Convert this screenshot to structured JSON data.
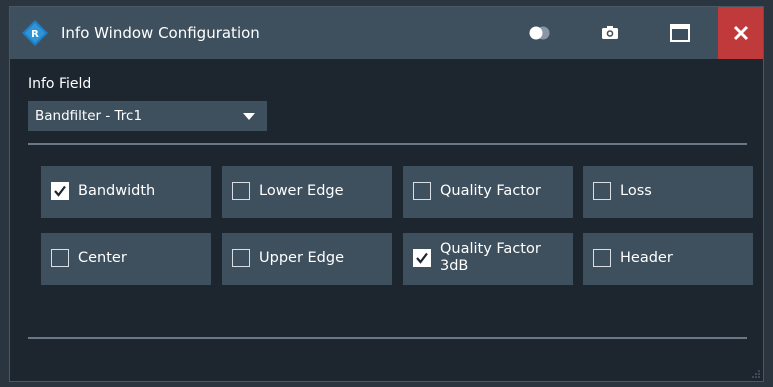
{
  "window": {
    "title": "Info Window Configuration",
    "toolbar_icons": [
      "toggle-icon",
      "camera-icon",
      "maximize-icon",
      "close-icon"
    ]
  },
  "info_field": {
    "label": "Info Field",
    "selected": "Bandfilter - Trc1"
  },
  "checkboxes": [
    {
      "label": "Bandwidth",
      "checked": true
    },
    {
      "label": "Lower Edge",
      "checked": false
    },
    {
      "label": "Quality Factor",
      "checked": false
    },
    {
      "label": "Loss",
      "checked": false
    },
    {
      "label": "Center",
      "checked": false
    },
    {
      "label": "Upper Edge",
      "checked": false
    },
    {
      "label": "Quality Factor 3dB",
      "checked": true
    },
    {
      "label": "Header",
      "checked": false
    }
  ],
  "colors": {
    "title_bar": "#3e4f5e",
    "background": "#1d262e",
    "close_button": "#c0393b",
    "text": "#ffffff"
  }
}
